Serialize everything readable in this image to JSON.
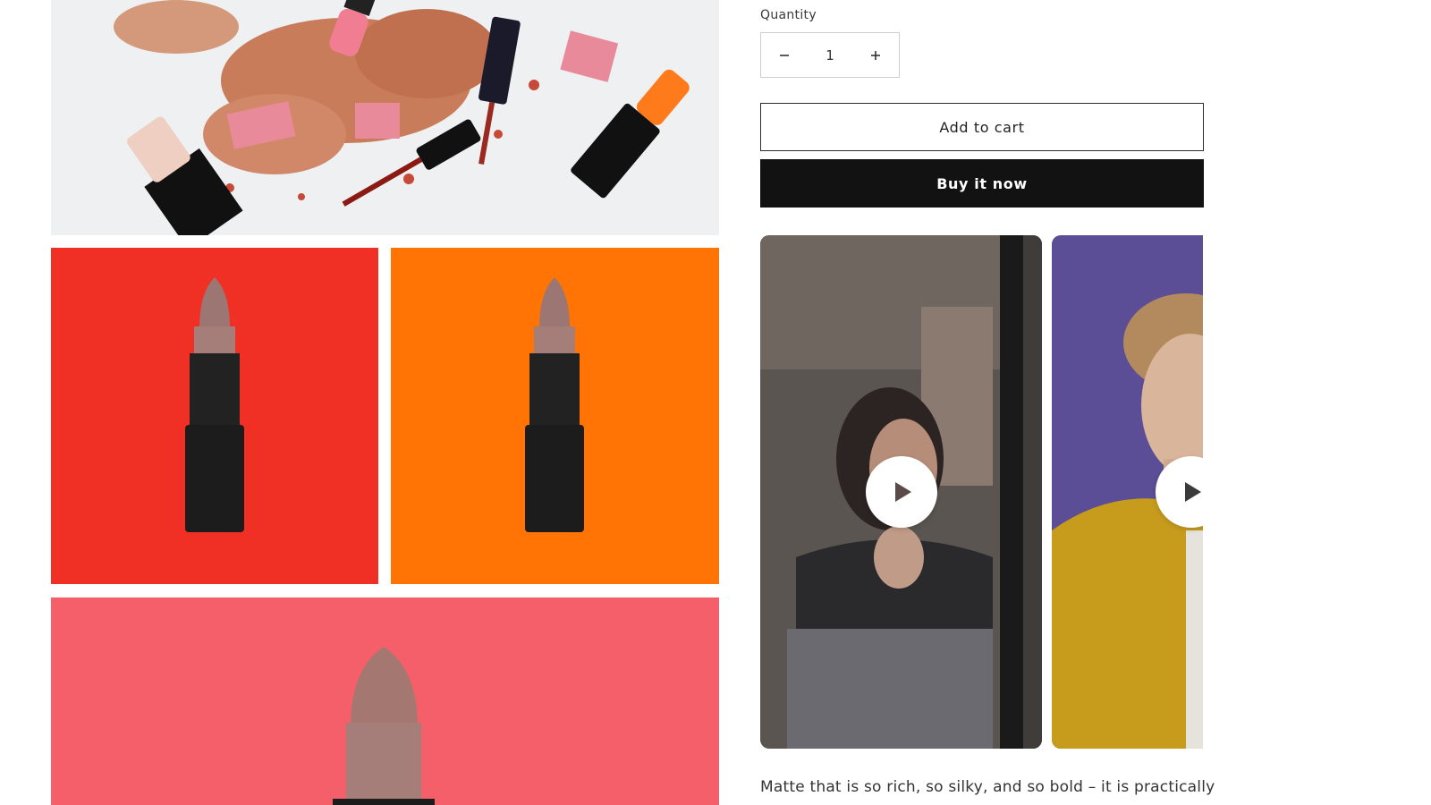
{
  "gallery": {
    "tiles": [
      {
        "name": "Cosmetics flatlay",
        "bg": "#eceef0"
      },
      {
        "name": "Lipstick on red",
        "bg": "#f03024"
      },
      {
        "name": "Lipstick on orange",
        "bg": "#ff7404"
      },
      {
        "name": "Lipstick on coral",
        "bg": "#f45f69"
      }
    ]
  },
  "quantity": {
    "label": "Quantity",
    "value": "1",
    "decrease_icon": "minus-icon",
    "increase_icon": "plus-icon"
  },
  "actions": {
    "add_to_cart_label": "Add to cart",
    "buy_now_label": "Buy it now"
  },
  "videos": [
    {
      "name": "makeup-mirror-video",
      "icon": "play-icon"
    },
    {
      "name": "model-yellow-jacket-video",
      "icon": "play-icon"
    }
  ],
  "description": {
    "text": "Matte that is so rich, so silky, and so bold – it is practically"
  },
  "colors": {
    "primary_button": "#121212",
    "tile_red": "#f03024",
    "tile_orange": "#ff7404",
    "tile_coral": "#f45f69"
  }
}
